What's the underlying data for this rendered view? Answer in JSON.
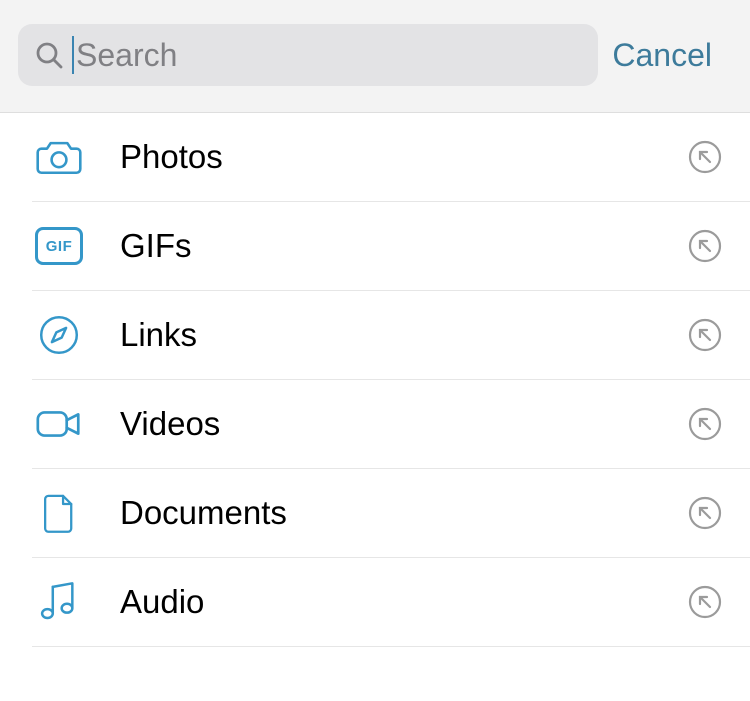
{
  "search": {
    "placeholder": "Search",
    "value": ""
  },
  "cancel_label": "Cancel",
  "categories": [
    {
      "id": "photos",
      "label": "Photos",
      "icon": "camera-icon"
    },
    {
      "id": "gifs",
      "label": "GIFs",
      "icon": "gif-icon"
    },
    {
      "id": "links",
      "label": "Links",
      "icon": "compass-icon"
    },
    {
      "id": "videos",
      "label": "Videos",
      "icon": "video-icon"
    },
    {
      "id": "documents",
      "label": "Documents",
      "icon": "document-icon"
    },
    {
      "id": "audio",
      "label": "Audio",
      "icon": "audio-icon"
    }
  ]
}
